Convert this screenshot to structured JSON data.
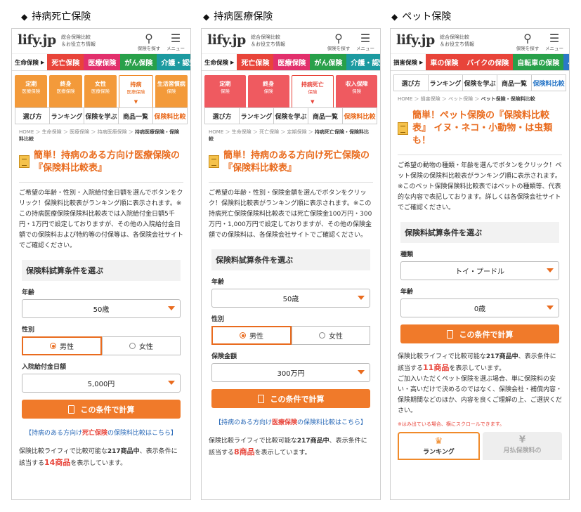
{
  "columns": [
    {
      "label": "持病死亡保険"
    },
    {
      "label": "持病医療保険"
    },
    {
      "label": "ペット保険"
    }
  ],
  "header": {
    "logo": "lify.jp",
    "tagline1": "総合保険比較",
    "tagline2": "＆お役立ち情報",
    "search_label": "保険を探す",
    "menu_label": "メニュー",
    "search_icon": "search-icon",
    "menu_icon": "hamburger-icon"
  },
  "p1": {
    "cat_first": "生命保険",
    "cats": [
      "死亡保険",
      "医療保険",
      "がん保険",
      "介護・認知"
    ],
    "subtabs": [
      {
        "t": "定期",
        "s": "医療保険"
      },
      {
        "t": "終身",
        "s": "医療保険"
      },
      {
        "t": "女性",
        "s": "医療保険"
      },
      {
        "t": "持病",
        "s": "医療保険"
      },
      {
        "t": "生活習慣病",
        "s": "保険"
      }
    ],
    "nav": [
      "選び方",
      "ランキング",
      "保険を学ぶ",
      "商品一覧",
      "保険料比較"
    ],
    "crumb_pre": "HOME ＞ 生命保険 ＞ 医療保険 ＞ 持病医療保険 ＞",
    "crumb_cur": "持病医療保険・保険料比較",
    "title": "簡単！持病のある方向け医療保険の『保険料比較表』",
    "desc": "ご希望の年齢・性別・入院給付金日額を選んでボタンをクリック！保険料比較表がランキング順に表示されます。※この持病医療保険保険料比較表では入院給付金日額5千円・1万円で設定しておりますが、その他の入院給付金日額での保険料および特約等の付保等は、各保険会社サイトでご確認ください。",
    "section": "保険料試算条件を選ぶ",
    "age_label": "年齢",
    "age_value": "50歳",
    "gender_label": "性別",
    "male": "男性",
    "female": "女性",
    "third_label": "入院給付金日額",
    "third_value": "5,000円",
    "calc": "この条件で計算",
    "link_pre": "【持病のある方向け",
    "link_hl": "死亡保険",
    "link_post": "の保険料比較はこちら】",
    "foot_pre": "保険比較ライフィで比較可能な",
    "foot_count": "217商品中",
    "foot_mid": "、表示条件に該当する",
    "foot_hl": "14商品",
    "foot_post": "を表示しています。"
  },
  "p2": {
    "cat_first": "生命保険",
    "cats": [
      "死亡保険",
      "医療保険",
      "がん保険",
      "介護・認知"
    ],
    "subtabs": [
      {
        "t": "定期",
        "s": "保険"
      },
      {
        "t": "終身",
        "s": "保険"
      },
      {
        "t": "持病死亡",
        "s": "保険"
      },
      {
        "t": "収入保障",
        "s": "保険"
      }
    ],
    "nav": [
      "選び方",
      "ランキング",
      "保険を学ぶ",
      "商品一覧",
      "保険料比較"
    ],
    "crumb_pre": "HOME ＞ 生命保険 ＞ 死亡保険 ＞ 定期保険 ＞",
    "crumb_cur": "持病死亡保険・保険料比較",
    "title": "簡単！持病のある方向け死亡保険の『保険料比較表』",
    "desc": "ご希望の年齢・性別・保険金額を選んでボタンをクリック！保険料比較表がランキング順に表示されます。※この持病死亡保険保険料比較表では死亡保険金100万円・300万円・1,000万円で設定しておりますが、その他の保険金額での保険料は、各保険会社サイトでご確認ください。",
    "section": "保険料試算条件を選ぶ",
    "age_label": "年齢",
    "age_value": "50歳",
    "gender_label": "性別",
    "male": "男性",
    "female": "女性",
    "third_label": "保険金額",
    "third_value": "300万円",
    "calc": "この条件で計算",
    "link_pre": "【持病のある方向け",
    "link_hl": "医療保険",
    "link_post": "の保険料比較はこちら】",
    "foot_pre": "保険比較ライフィで比較可能な",
    "foot_count": "217商品中",
    "foot_mid": "、表示条件に該当する",
    "foot_hl": "8商品",
    "foot_post": "を表示しています。"
  },
  "p3": {
    "cat_first": "損害保険",
    "cats": [
      "車の保険",
      "バイクの保険",
      "自転車の保険",
      "ペッ"
    ],
    "nav": [
      "選び方",
      "ランキング",
      "保険を学ぶ",
      "商品一覧",
      "保険料比較"
    ],
    "crumb_pre": "HOME ＞ 損害保険 ＞ ペット保険 ＞",
    "crumb_cur": "ペット保険・保険料比較",
    "title": "簡単！ペット保険の『保険料比較表』 イヌ・ネコ・小動物・は虫類も！",
    "desc": "ご希望の動物の種類・年齢を選んでボタンをクリック！ペット保険の保険料比較表がランキング順に表示されます。※このペット保険保険料比較表ではペットの種類等、代表的な内容で表記しております。詳しくは各保険会社サイトでご確認ください。",
    "section": "保険料試算条件を選ぶ",
    "type_label": "種類",
    "type_value": "トイ・プードル",
    "age_label": "年齢",
    "age_value": "0歳",
    "calc": "この条件で計算",
    "foot_pre": "保険比較ライフィで比較可能な",
    "foot_count": "217商品中",
    "foot_mid": "、表示条件に該当する",
    "foot_hl": "11商品",
    "foot_post": "を表示しています。",
    "foot2": "ご加入いただくペット保険を選ぶ場合、単に保険料の安い・高いだけで決めるのではなく、保険会社・補償内容・保険期間などのほか、内容を良くご理解の上、ご選択ください。",
    "note": "※はみ出ている場合、横にスクロールできます。",
    "rank_tab": "ランキング",
    "price_tab": "月払保険料の"
  }
}
